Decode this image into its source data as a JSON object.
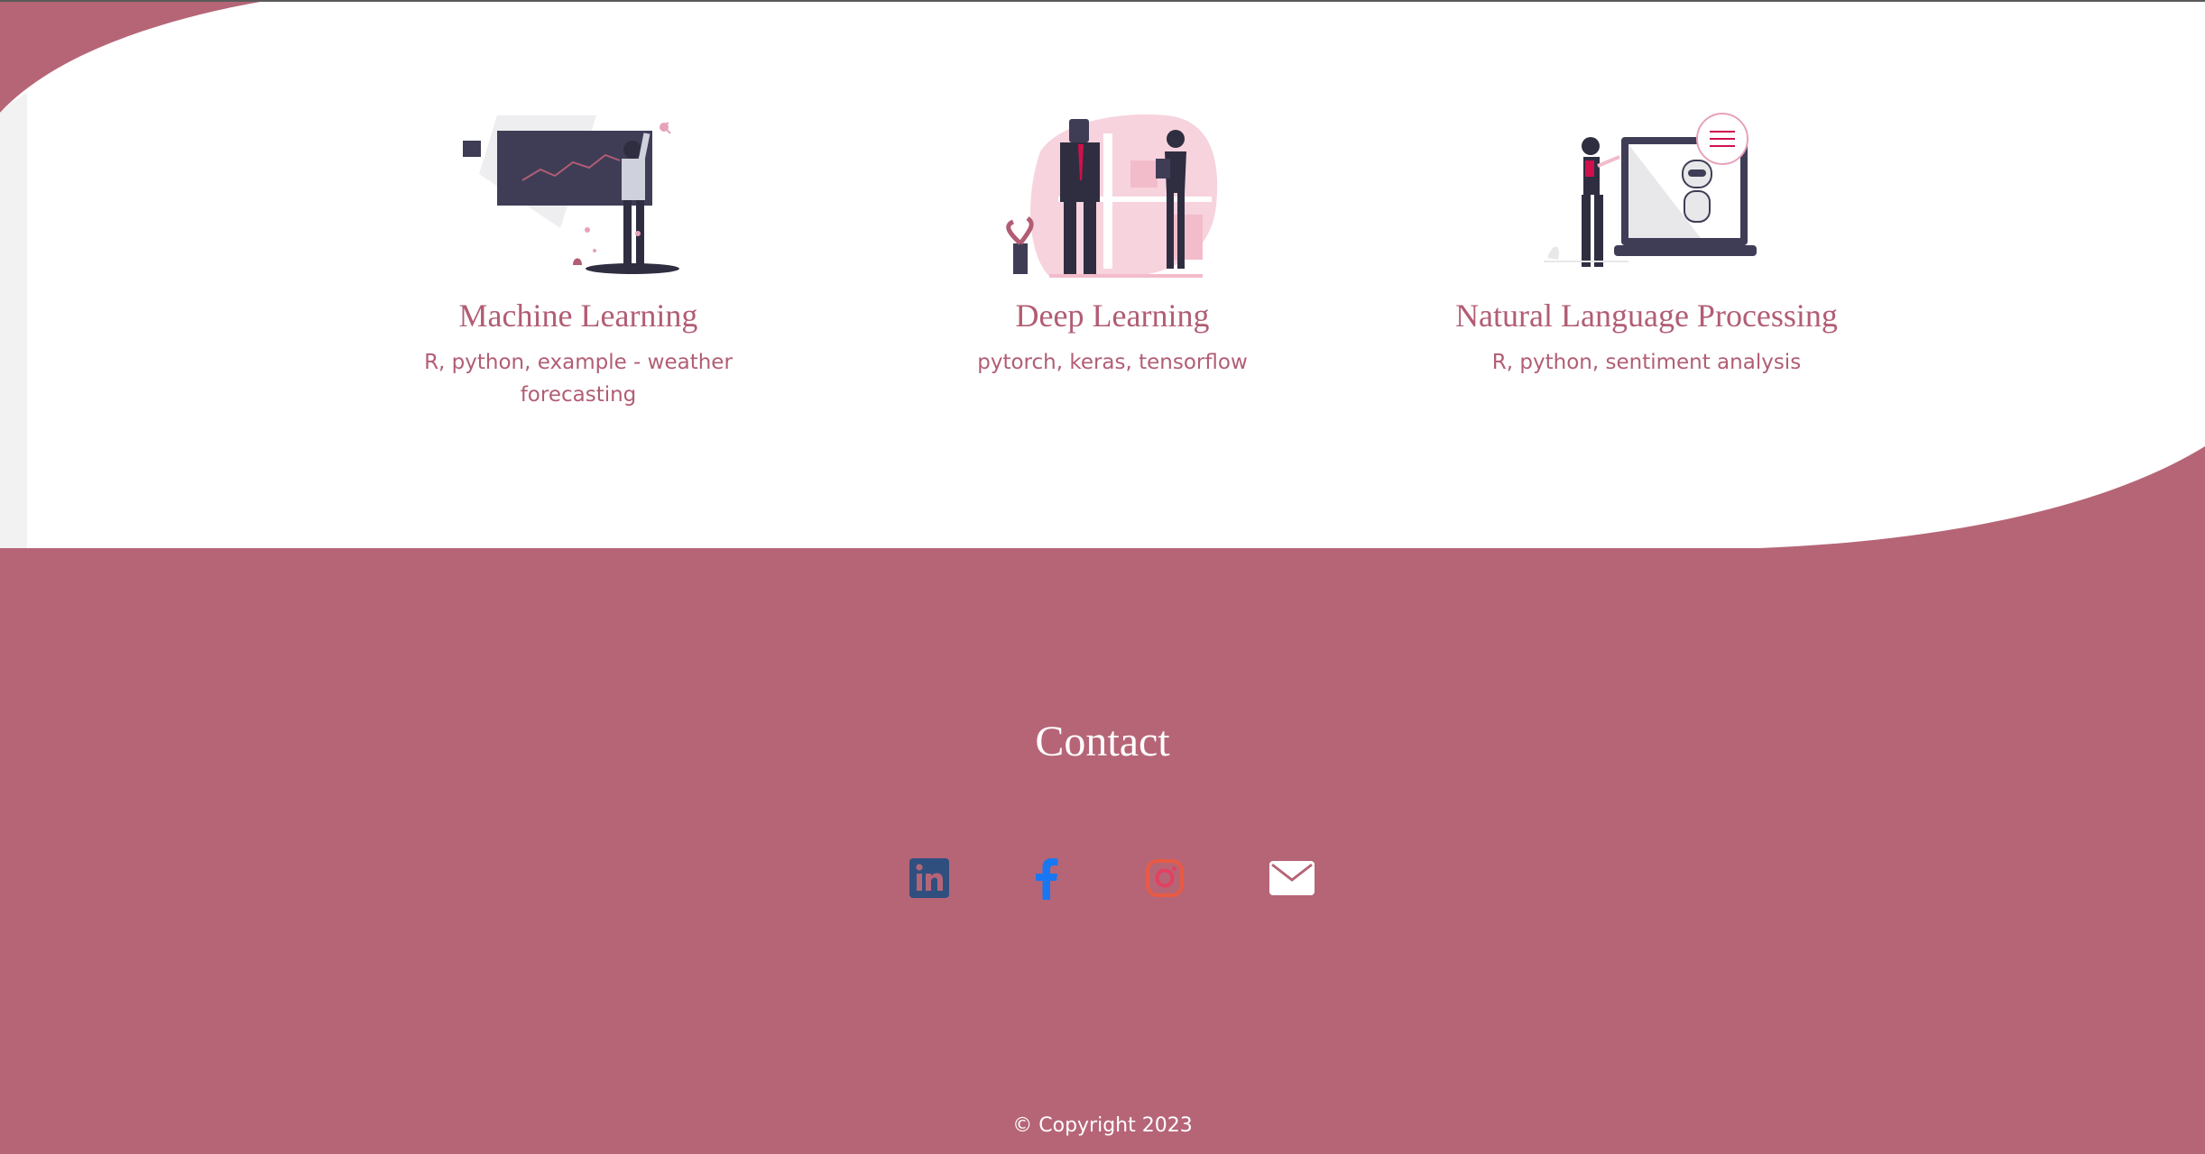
{
  "colors": {
    "accent": "#b66577",
    "title_text": "#b25d74",
    "background_top": "#ffffff",
    "linkedin": "#2f4f7f",
    "facebook": "#1877f2",
    "instagram": "#e4405f",
    "email": "#ffffff"
  },
  "skills": [
    {
      "title": "Machine Learning",
      "description": "R, python, example - weather forecasting",
      "illustration": "person-presenting-chart-illustration"
    },
    {
      "title": "Deep Learning",
      "description": "pytorch, keras, tensorflow",
      "illustration": "robot-and-person-with-clipboard-illustration"
    },
    {
      "title": "Natural Language Processing",
      "description": "R, python, sentiment analysis",
      "illustration": "person-with-chatbot-laptop-illustration"
    }
  ],
  "contact": {
    "title": "Contact",
    "links": [
      {
        "icon": "linkedin-icon"
      },
      {
        "icon": "facebook-icon"
      },
      {
        "icon": "instagram-icon"
      },
      {
        "icon": "envelope-icon"
      }
    ]
  },
  "footer": {
    "copyright": "© Copyright 2023"
  }
}
